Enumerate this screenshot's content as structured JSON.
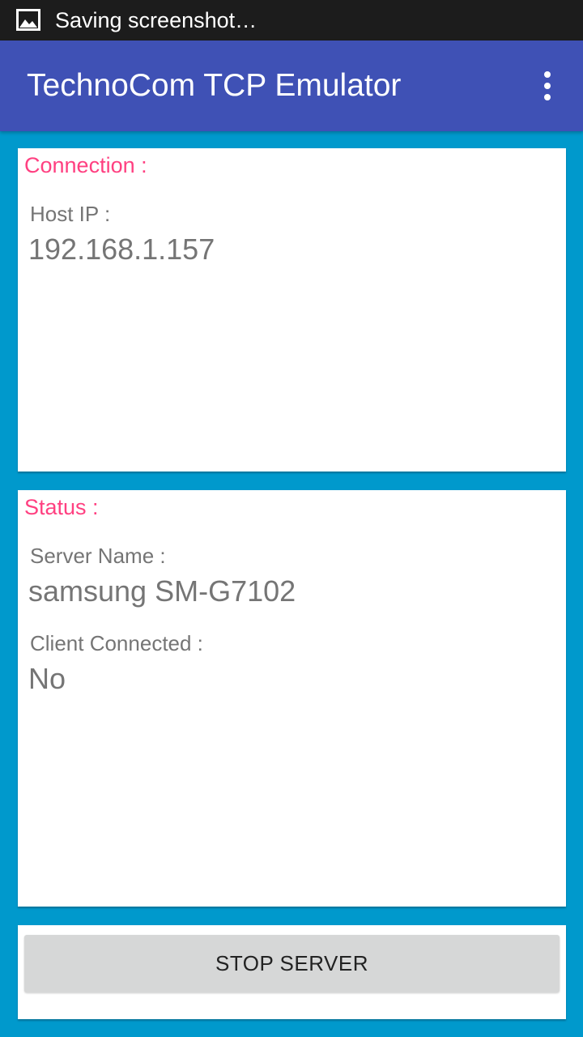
{
  "status_bar": {
    "notification_icon": "image-icon",
    "notification_text": "Saving screenshot…"
  },
  "app_bar": {
    "title": "TechnoCom TCP Emulator",
    "overflow_icon": "more-vert-icon"
  },
  "connection": {
    "title": "Connection :",
    "host_ip_label": "Host IP :",
    "host_ip_value": "192.168.1.157"
  },
  "status": {
    "title": "Status :",
    "server_name_label": "Server Name :",
    "server_name_value": "samsung SM-G7102",
    "client_connected_label": "Client Connected :",
    "client_connected_value": "No"
  },
  "actions": {
    "stop_server_label": "STOP SERVER"
  },
  "colors": {
    "background": "#0099CC",
    "app_bar": "#3F51B5",
    "status_bar": "#1C1C1C",
    "accent": "#FF4081",
    "button": "#D6D7D7"
  }
}
